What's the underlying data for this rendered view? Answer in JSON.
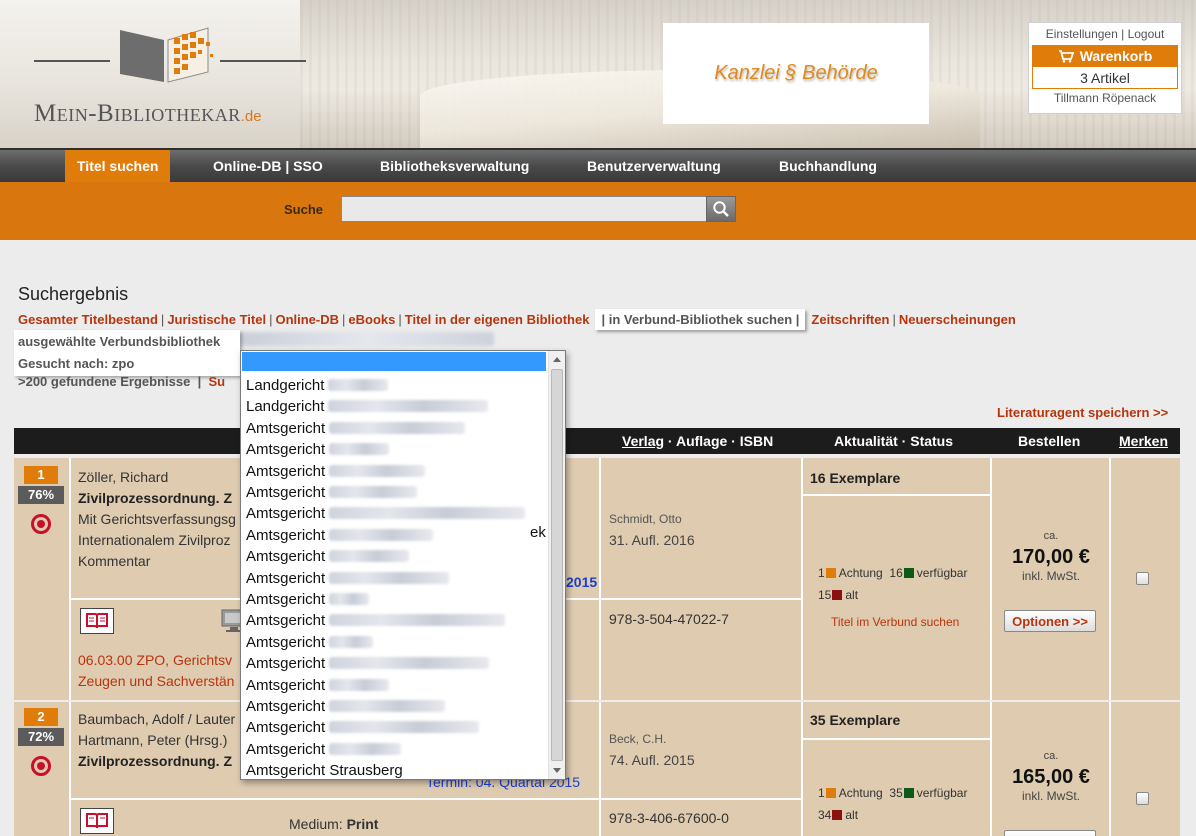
{
  "header": {
    "logo_text": "Mein-Bibliothekar",
    "logo_tld": ".de",
    "partner_logo": "Kanzlei § Behörde",
    "account_links": [
      "Einstellungen",
      "Logout"
    ],
    "cart_label": "Warenkorb",
    "cart_count": "3 Artikel",
    "user_name": "Tillmann Röpenack"
  },
  "nav": {
    "items": [
      "Titel suchen",
      "Online-DB | SSO",
      "Bibliotheksverwaltung",
      "Benutzerverwaltung",
      "Buchhandlung"
    ],
    "active": "Titel suchen"
  },
  "search": {
    "label": "Suche",
    "value": ""
  },
  "results": {
    "title": "Suchergebnis",
    "filter_links": [
      "Gesamter Titelbestand",
      "Juristische Titel",
      "Online-DB",
      "eBooks",
      "Titel in der eigenen Bibliothek",
      "in Verbund-Bibliothek suchen",
      "Zeitschriften",
      "Neuerscheinungen"
    ],
    "selected_filter": "in Verbund-Bibliothek suchen",
    "verbund_label": "ausgewählte Verbundsbibliothek",
    "searched_for": "Gesucht nach: zpo",
    "found_count": ">200 gefundene Ergebnisse",
    "found_sep": "|",
    "found_suffix": "Su",
    "literaturagent": "Literaturagent speichern >>",
    "columns": {
      "verlag": "Verlag",
      "verlag_rest": " · Auflage · ISBN",
      "aktualitaet": "Aktualität · Status",
      "bestellen": "Bestellen",
      "merken": "Merken"
    }
  },
  "rows": [
    {
      "rank": "1",
      "percent": "76%",
      "authors": "Zöller, Richard",
      "title": "Zivilprozessordnung. Z",
      "desc": [
        "Mit Gerichtsverfassungsg",
        "Internationalem Zivilproz",
        "Kommentar"
      ],
      "year_link": "2015",
      "publisher": "Schmidt, Otto",
      "edition": "31. Aufl. 2016",
      "isbn": "978-3-504-47022-7",
      "exemplare": "16 Exemplare",
      "achtung_n": "1",
      "achtung": "Achtung",
      "verfuegbar_n": "16",
      "verfuegbar": "verfügbar",
      "alt_n": "15",
      "alt": "alt",
      "verbund_link": "Titel im Verbund suchen",
      "price_ca": "ca.",
      "price": "170,00 €",
      "price_note": "inkl. MwSt.",
      "options": "Optionen >>",
      "classification": [
        "06.03.00 ZPO, Gerichtsv",
        "Zeugen und Sachverstän"
      ]
    },
    {
      "rank": "2",
      "percent": "72%",
      "authors": "Baumbach, Adolf / Lauter",
      "authors2": "Hartmann, Peter (Hrsg.)",
      "title": "Zivilprozessordnung. Z",
      "termin": "Termin: 04. Quartal 2015",
      "publisher": "Beck, C.H.",
      "edition": "74. Aufl. 2015",
      "isbn": "978-3-406-67600-0",
      "exemplare": "35 Exemplare",
      "achtung_n": "1",
      "achtung": "Achtung",
      "verfuegbar_n": "35",
      "verfuegbar": "verfügbar",
      "alt_n": "34",
      "alt": "alt",
      "price_ca": "ca.",
      "price": "165,00 €",
      "price_note": "inkl. MwSt.",
      "medium_label": "Medium:",
      "medium": "Print"
    }
  ],
  "dropdown": {
    "options": [
      "Landgericht",
      "Landgericht",
      "Amtsgericht",
      "Amtsgericht",
      "Amtsgericht",
      "Amtsgericht",
      "Amtsgericht",
      "Amtsgericht",
      "Amtsgericht",
      "Amtsgericht",
      "Amtsgericht",
      "Amtsgericht",
      "Amtsgericht",
      "Amtsgericht",
      "Amtsgericht",
      "Amtsgericht",
      "Amtsgericht",
      "Amtsgericht",
      "Amtsgericht Strausberg"
    ],
    "partial_visible": "ek"
  },
  "colors": {
    "accent": "#e07c0a",
    "link": "#b7350d",
    "nav": "#4a4a4a",
    "cell": "#dfcbb0"
  }
}
